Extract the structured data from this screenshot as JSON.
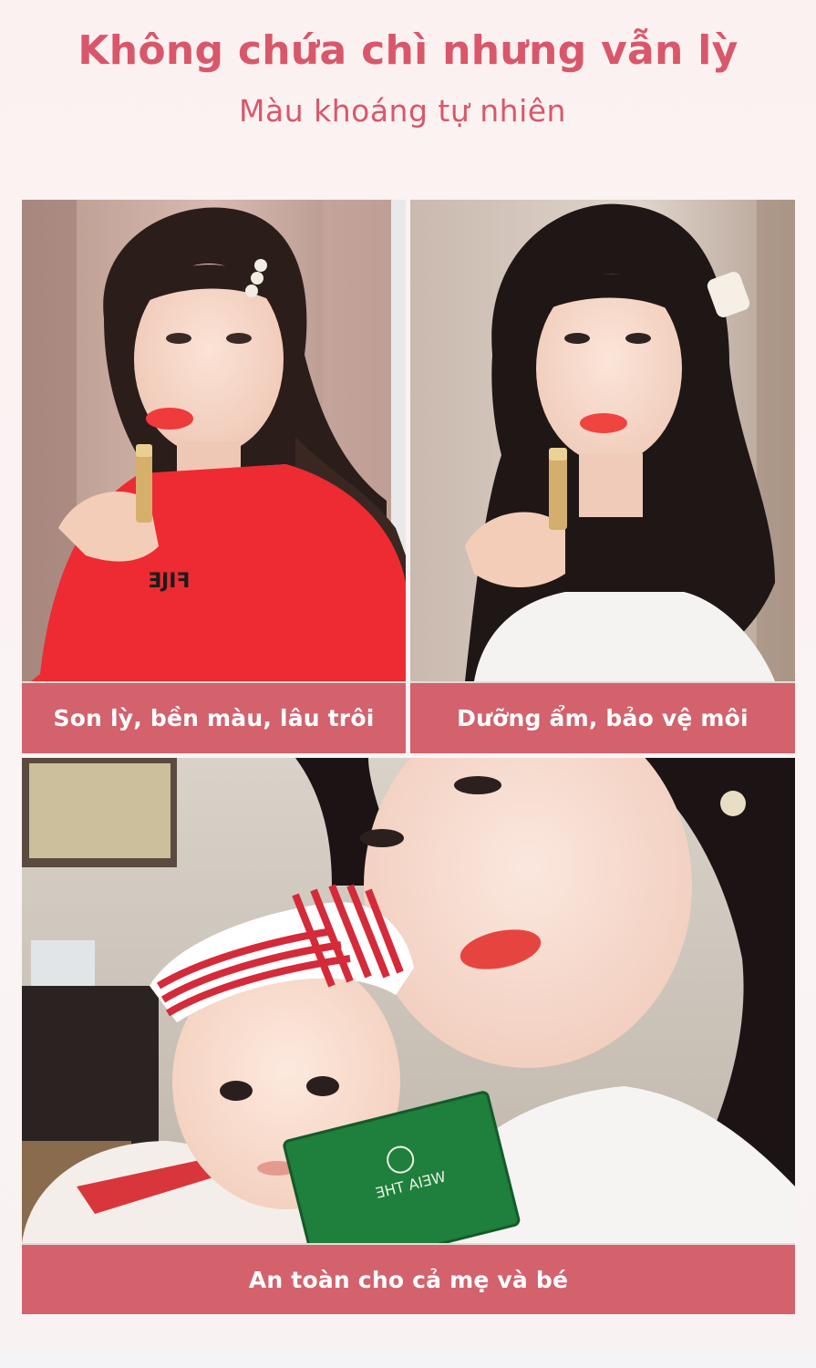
{
  "header": {
    "title": "Không chứa chì nhưng vẫn lỳ",
    "subtitle": "Màu khoáng tự nhiên"
  },
  "cards": [
    {
      "caption": "Son lỳ, bền màu, lâu trôi",
      "shirt_logo": "ƎJIꟻ"
    },
    {
      "caption": "Dưỡng ẩm, bảo vệ môi"
    },
    {
      "caption": "An toàn cho cả mẹ và bé",
      "booklet_text": "ƎHT AIƎW"
    }
  ],
  "colors": {
    "accent": "#d9576a",
    "caption_bar": "#d3626d",
    "background": "#fbf3f3",
    "lipstick_red": "#ef3b3b",
    "shirt_red": "#ee2b32",
    "booklet_green": "#1f7f3c"
  }
}
